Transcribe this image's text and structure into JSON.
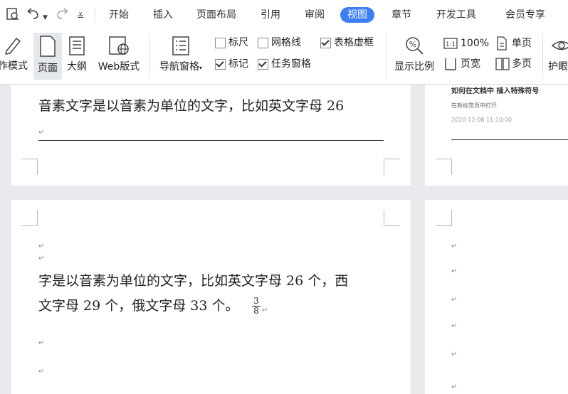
{
  "menu": {
    "tabs": [
      "开始",
      "插入",
      "页面布局",
      "引用",
      "审阅",
      "视图",
      "章节",
      "开发工具",
      "会员专享"
    ],
    "active_tab": "视图"
  },
  "ribbon": {
    "write_mode": "作模式",
    "page": "页面",
    "outline": "大纲",
    "web_layout": "Web版式",
    "nav_pane": "导航窗格",
    "ruler": "标尺",
    "gridlines": "网格线",
    "table_gridlines": "表格虚框",
    "marks": "标记",
    "task_pane": "任务窗格",
    "zoom": "显示比例",
    "zoom_100": "100%",
    "single_page": "单页",
    "page_width": "页宽",
    "multi_page": "多页",
    "eye_protect": "护眼",
    "checkboxes": {
      "ruler": false,
      "gridlines": false,
      "table_gridlines": true,
      "marks": true,
      "task_pane": true
    }
  },
  "document": {
    "page1_line": "音素文字是以音素为单位的文字，比如英文字母 26",
    "page2_line1": "字是以音素为单位的文字，比如英文字母 26 个，西",
    "page2_line2": "文字母 29 个，俄文字母 33 个。",
    "fraction_num": "3",
    "fraction_den": "8",
    "right_title": "如何在文档中  插入特殊符号",
    "right_line1": "在新标签页中打开",
    "right_line2": "2020-12-08 11:10:00"
  },
  "colors": {
    "active_tab_bg": "#3d7ef0",
    "background": "#e8eaed"
  }
}
